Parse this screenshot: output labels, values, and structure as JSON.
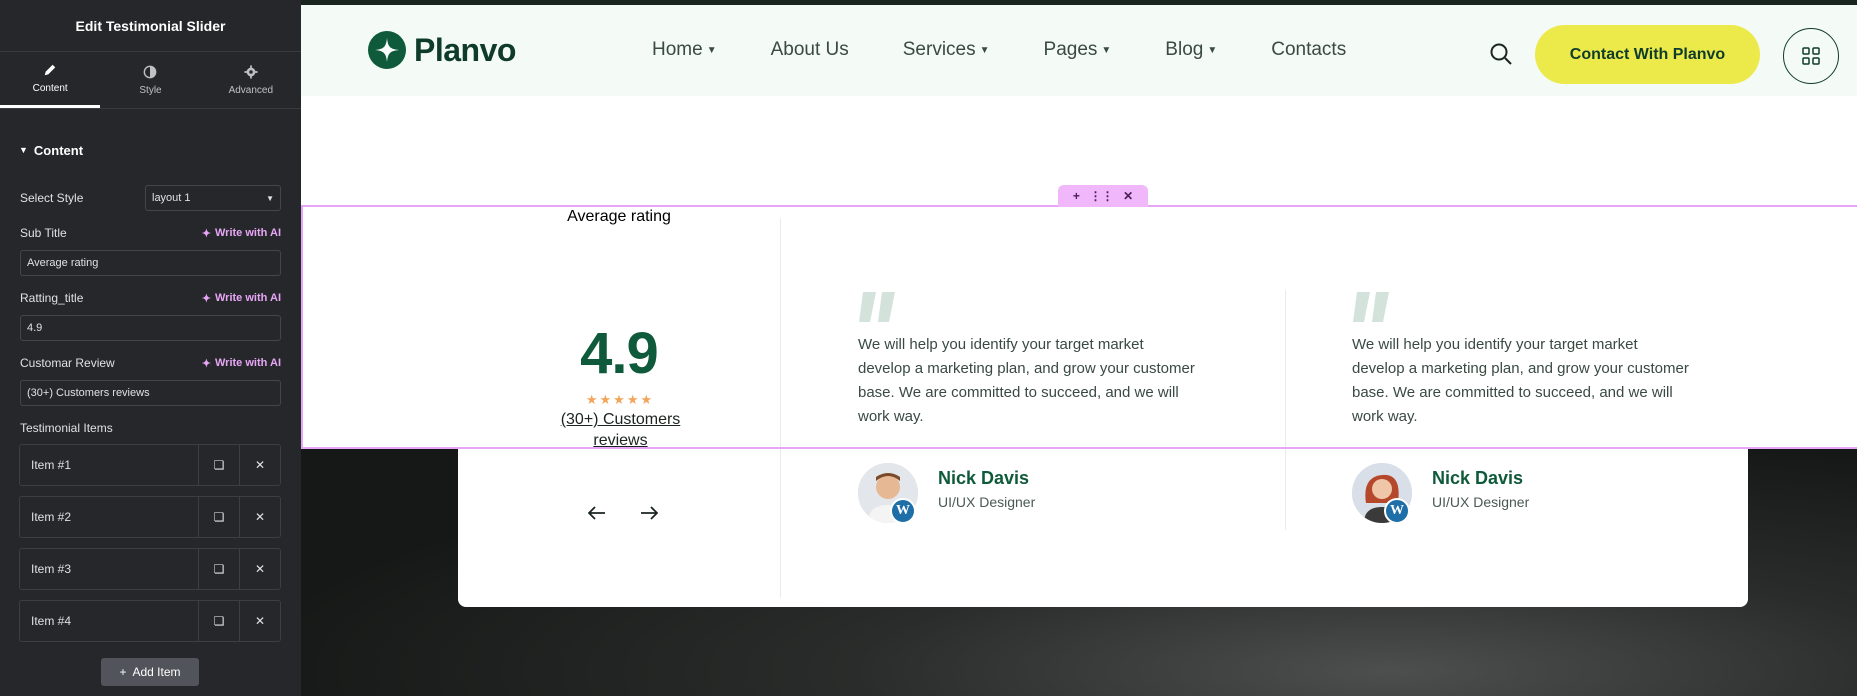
{
  "panel": {
    "title": "Edit Testimonial Slider",
    "tabs": [
      {
        "label": "Content",
        "icon": "pencil-icon"
      },
      {
        "label": "Style",
        "icon": "half-circle-icon"
      },
      {
        "label": "Advanced",
        "icon": "gear-icon"
      }
    ],
    "section_title": "Content",
    "select_style_label": "Select Style",
    "select_style_value": "layout 1",
    "write_ai": "Write with AI",
    "sub_title_label": "Sub Title",
    "sub_title_value": "Average rating",
    "ratting_title_label": "Ratting_title",
    "ratting_title_value": "4.9",
    "customar_review_label": "Customar Review",
    "customar_review_value": "(30+) Customers reviews",
    "items_label": "Testimonial Items",
    "items": [
      "Item #1",
      "Item #2",
      "Item #3",
      "Item #4"
    ],
    "add_item": "Add Item"
  },
  "header": {
    "logo_text": "Planvo",
    "nav": [
      {
        "label": "Home",
        "dropdown": true
      },
      {
        "label": "About Us",
        "dropdown": false
      },
      {
        "label": "Services",
        "dropdown": true
      },
      {
        "label": "Pages",
        "dropdown": true
      },
      {
        "label": "Blog",
        "dropdown": true
      },
      {
        "label": "Contacts",
        "dropdown": false
      }
    ],
    "cta": "Contact With Planvo"
  },
  "testimonial": {
    "sub_title": "Average rating",
    "rating": "4.9",
    "stars": 5,
    "reviews": "(30+) Customers reviews",
    "cards": [
      {
        "quote": "We will help you identify your target market develop a marketing plan, and grow your customer base. We are committed to succeed, and we will work way.",
        "name": "Nick Davis",
        "role": "UI/UX Designer"
      },
      {
        "quote": "We will help you identify your target market develop a marketing plan, and grow your customer base. We are committed to succeed, and we will work way.",
        "name": "Nick Davis",
        "role": "UI/UX Designer"
      }
    ]
  },
  "colors": {
    "brand_green": "#0f5a3a",
    "cta_yellow": "#ecea4a",
    "selection_pink": "#e7a6f5",
    "star_orange": "#f2a55a"
  }
}
